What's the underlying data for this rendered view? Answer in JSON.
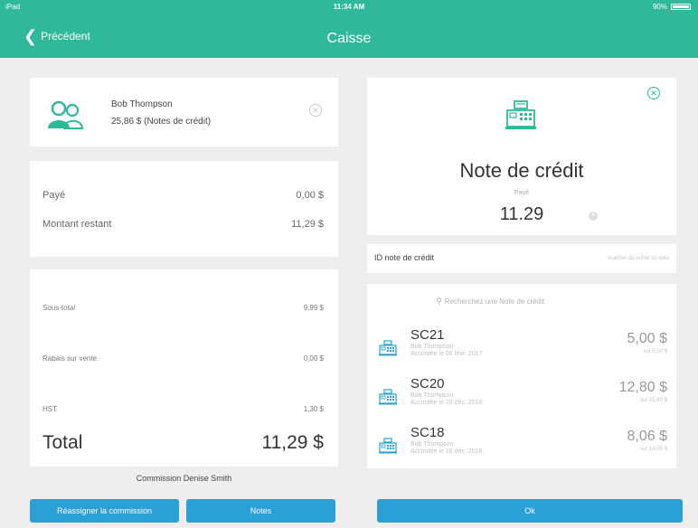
{
  "statusbar": {
    "device": "iPad",
    "time": "11:34 AM",
    "battery": "90%"
  },
  "nav": {
    "back_label": "Précédent",
    "title": "Caisse"
  },
  "customer": {
    "name": "Bob Thompson",
    "credit": "25,86 $  (Notes de crédit)",
    "avatar_icon": "customers-icon"
  },
  "payment": {
    "paid_label": "Payé",
    "paid_value": "0,00 $",
    "remaining_label": "Montant restant",
    "remaining_value": "11,29 $"
  },
  "totals": {
    "subtotal_label": "Sous-total",
    "subtotal_value": "9,99 $",
    "discount_label": "Rabais sur vente",
    "discount_value": "0,00 $",
    "tax_label": "HST",
    "tax_value": "1,30 $",
    "total_label": "Total",
    "total_value": "11,29 $"
  },
  "commission": "Commission Denise Smith",
  "buttons": {
    "reassign": "Réassigner la commission",
    "notes": "Notes",
    "ok": "Ok"
  },
  "credit_panel": {
    "title": "Note de crédit",
    "paid_label": "Payé",
    "amount": "11.29",
    "id_label": "ID note de crédit",
    "id_placeholder": "Scanner ou entrer ID note"
  },
  "search": {
    "placeholder": "Recherchez une Note de crédit"
  },
  "credit_notes": [
    {
      "id": "SC21",
      "customer": "Bob Thompson",
      "date": "Accordée le 08 févr. 2017",
      "amount": "5,00 $",
      "of": "sur 5,00 $"
    },
    {
      "id": "SC20",
      "customer": "Bob Thompson",
      "date": "Accordée le 20 déc. 2016",
      "amount": "12,80 $",
      "of": "sur 15,80 $"
    },
    {
      "id": "SC18",
      "customer": "Bob Thompson",
      "date": "Accordée le 16 déc. 2016",
      "amount": "8,06 $",
      "of": "sur 14,09 $"
    }
  ],
  "colors": {
    "brand": "#2fb99a",
    "button": "#2aa0d6",
    "background": "#eeeeee"
  }
}
